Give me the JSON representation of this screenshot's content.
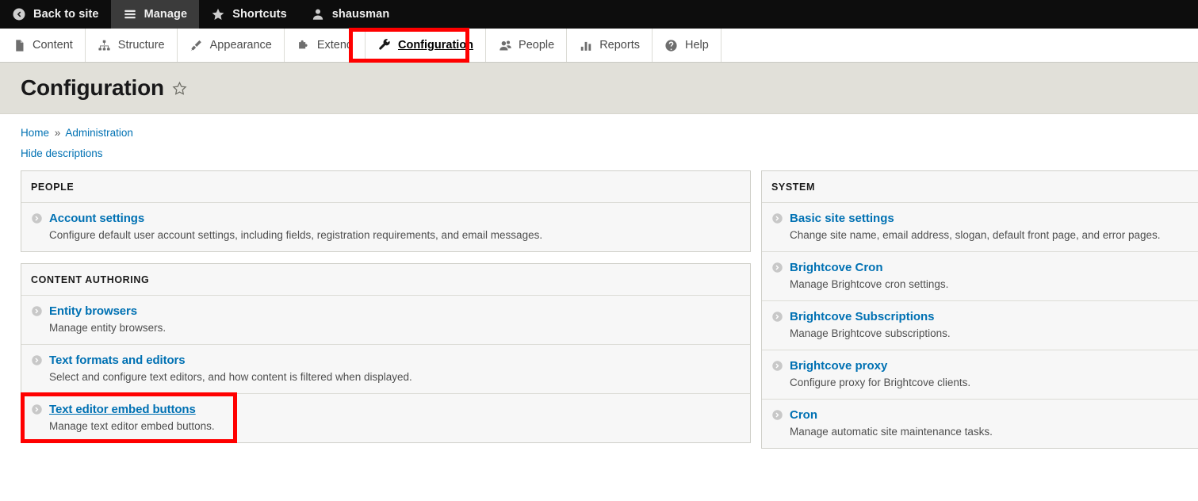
{
  "toolbar": {
    "items": [
      {
        "label": "Back to site",
        "icon": "back-arrow-circle-icon",
        "active": false
      },
      {
        "label": "Manage",
        "icon": "hamburger-menu-icon",
        "active": true
      },
      {
        "label": "Shortcuts",
        "icon": "star-icon",
        "active": false
      },
      {
        "label": "shausman",
        "icon": "user-account-icon",
        "active": false
      }
    ]
  },
  "tabs": {
    "items": [
      {
        "label": "Content",
        "icon": "page-document-icon",
        "current": false
      },
      {
        "label": "Structure",
        "icon": "hierarchy-icon",
        "current": false
      },
      {
        "label": "Appearance",
        "icon": "paintbrush-icon",
        "current": false
      },
      {
        "label": "Extend",
        "icon": "puzzle-piece-icon",
        "current": false
      },
      {
        "label": "Configuration",
        "icon": "wrench-icon",
        "current": true
      },
      {
        "label": "People",
        "icon": "people-icon",
        "current": false
      },
      {
        "label": "Reports",
        "icon": "bar-chart-icon",
        "current": false
      },
      {
        "label": "Help",
        "icon": "question-mark-icon",
        "current": false
      }
    ]
  },
  "page": {
    "title": "Configuration",
    "star_icon": "favorite-star-outline-icon",
    "breadcrumb": {
      "home": "Home",
      "separator": "»",
      "current": "Administration"
    },
    "hide_descriptions": "Hide descriptions"
  },
  "left_column": {
    "panels": [
      {
        "heading": "PEOPLE",
        "items": [
          {
            "title": "Account settings",
            "description": "Configure default user account settings, including fields, registration requirements, and email messages.",
            "highlighted": false,
            "hovered": false
          }
        ]
      },
      {
        "heading": "CONTENT AUTHORING",
        "items": [
          {
            "title": "Entity browsers",
            "description": "Manage entity browsers.",
            "highlighted": false,
            "hovered": false
          },
          {
            "title": "Text formats and editors",
            "description": "Select and configure text editors, and how content is filtered when displayed.",
            "highlighted": false,
            "hovered": false
          },
          {
            "title": "Text editor embed buttons",
            "description": "Manage text editor embed buttons.",
            "highlighted": true,
            "hovered": true
          }
        ]
      }
    ]
  },
  "right_column": {
    "panels": [
      {
        "heading": "SYSTEM",
        "items": [
          {
            "title": "Basic site settings",
            "description": "Change site name, email address, slogan, default front page, and error pages.",
            "highlighted": false,
            "hovered": false
          },
          {
            "title": "Brightcove Cron",
            "description": "Manage Brightcove cron settings.",
            "highlighted": false,
            "hovered": false
          },
          {
            "title": "Brightcove Subscriptions",
            "description": "Manage Brightcove subscriptions.",
            "highlighted": false,
            "hovered": false
          },
          {
            "title": "Brightcove proxy",
            "description": "Configure proxy for Brightcove clients.",
            "highlighted": false,
            "hovered": false
          },
          {
            "title": "Cron",
            "description": "Manage automatic site maintenance tasks.",
            "highlighted": false,
            "hovered": false
          }
        ]
      }
    ]
  },
  "annotations": {
    "highlight_color": "#ff0000",
    "targets": [
      "Configuration",
      "Text editor embed buttons"
    ]
  },
  "colors": {
    "link": "#0071b3",
    "toolbar_bg": "#0d0d0d",
    "title_band": "#e1e0d9",
    "panel_bg": "#f7f7f7",
    "annotation": "#ff0000"
  }
}
